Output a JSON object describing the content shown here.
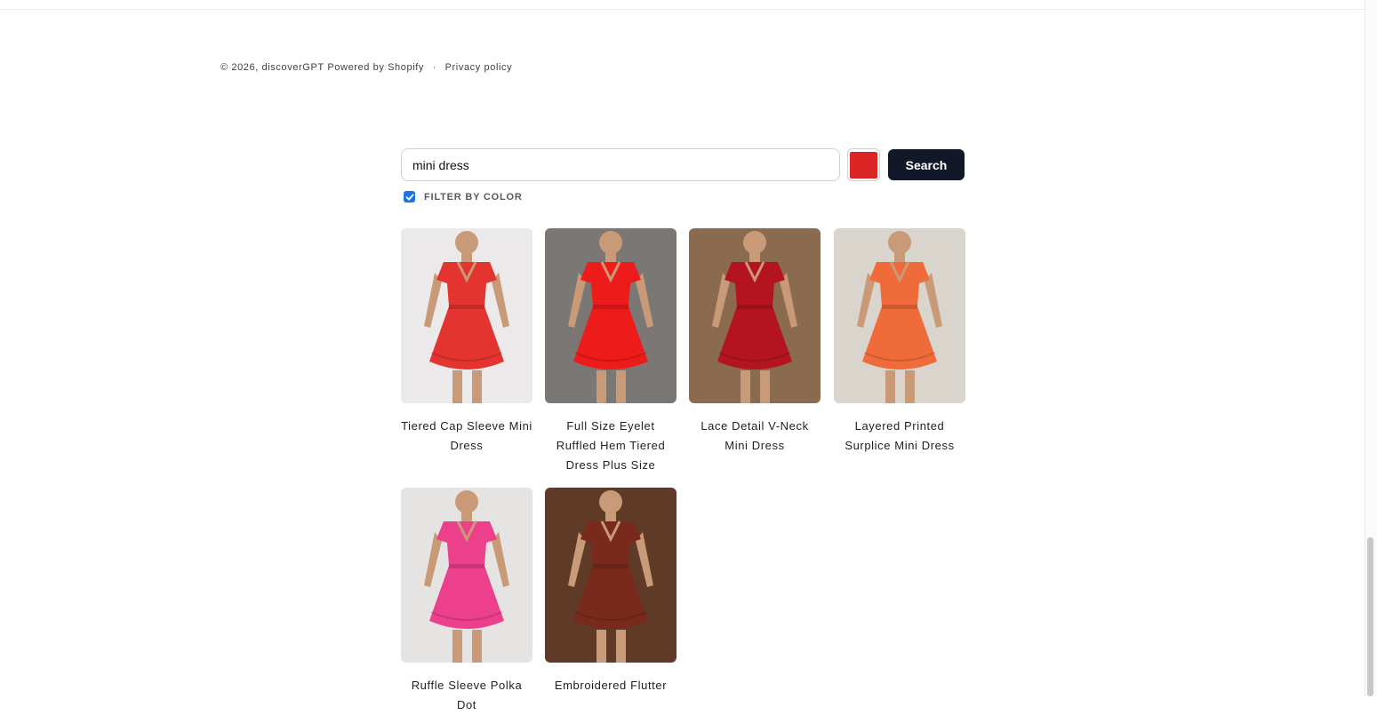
{
  "footer": {
    "copyright": "© 2026, discoverGPT",
    "powered_by": "Powered by Shopify",
    "separator": "·",
    "privacy_link": "Privacy policy"
  },
  "search": {
    "value": "mini dress",
    "placeholder": "",
    "button_label": "Search",
    "selected_color": "#dc2626",
    "filter_label": "FILTER BY COLOR",
    "filter_checked": true
  },
  "products": [
    {
      "title": "Tiered Cap Sleeve Mini Dress",
      "image_icon": "dress-photo",
      "dress_color": "#e3342f",
      "bg_color": "#ebe9ea"
    },
    {
      "title": "Full Size Eyelet Ruffled Hem Tiered Dress Plus Size",
      "image_icon": "dress-photo",
      "dress_color": "#ee1b1b",
      "bg_color": "#7b7774"
    },
    {
      "title": "Lace Detail V-Neck Mini Dress",
      "image_icon": "dress-photo",
      "dress_color": "#b4141f",
      "bg_color": "#8a6b4f"
    },
    {
      "title": "Layered Printed Surplice Mini Dress",
      "image_icon": "dress-photo",
      "dress_color": "#f06b3a",
      "bg_color": "#d9d4cc"
    },
    {
      "title": "Ruffle Sleeve Polka Dot",
      "image_icon": "dress-photo",
      "dress_color": "#ec3f8c",
      "bg_color": "#e6e4e3"
    },
    {
      "title": "Embroidered Flutter",
      "image_icon": "dress-photo",
      "dress_color": "#7a2a1c",
      "bg_color": "#5e3a27"
    }
  ]
}
